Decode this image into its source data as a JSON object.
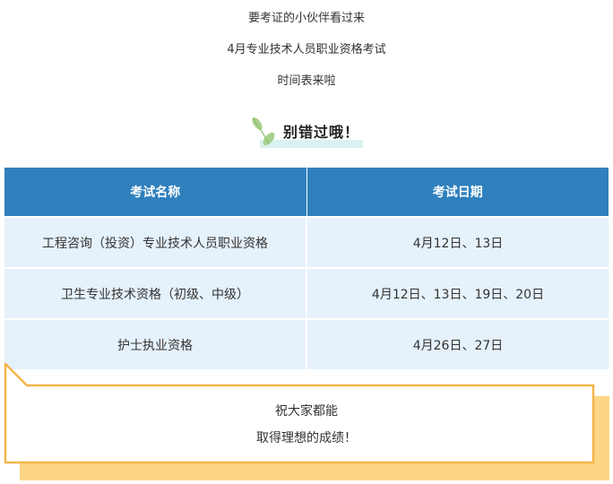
{
  "intro": {
    "line1": "要考证的小伙伴看过来",
    "line2": "4月专业技术人员职业资格考试",
    "line3": "时间表来啦"
  },
  "heading": {
    "text": "别错过哦！",
    "icon": "leaf-icon"
  },
  "table": {
    "headers": [
      "考试名称",
      "考试日期"
    ],
    "rows": [
      [
        "工程咨询（投资）专业技术人员职业资格",
        "4月12日、13日"
      ],
      [
        "卫生专业技术资格（初级、中级）",
        "4月12日、13日、19日、20日"
      ],
      [
        "护士执业资格",
        "4月26日、27日"
      ]
    ]
  },
  "card": {
    "line1": "祝大家都能",
    "line2": "取得理想的成绩！"
  },
  "colors": {
    "header_bg": "#2f80bd",
    "row_bg": "#e5f1fb",
    "card_border": "#f6b54a",
    "card_shadow": "#fcd585",
    "leaf": "#a9d18e",
    "highlight": "#d9f2f1"
  }
}
